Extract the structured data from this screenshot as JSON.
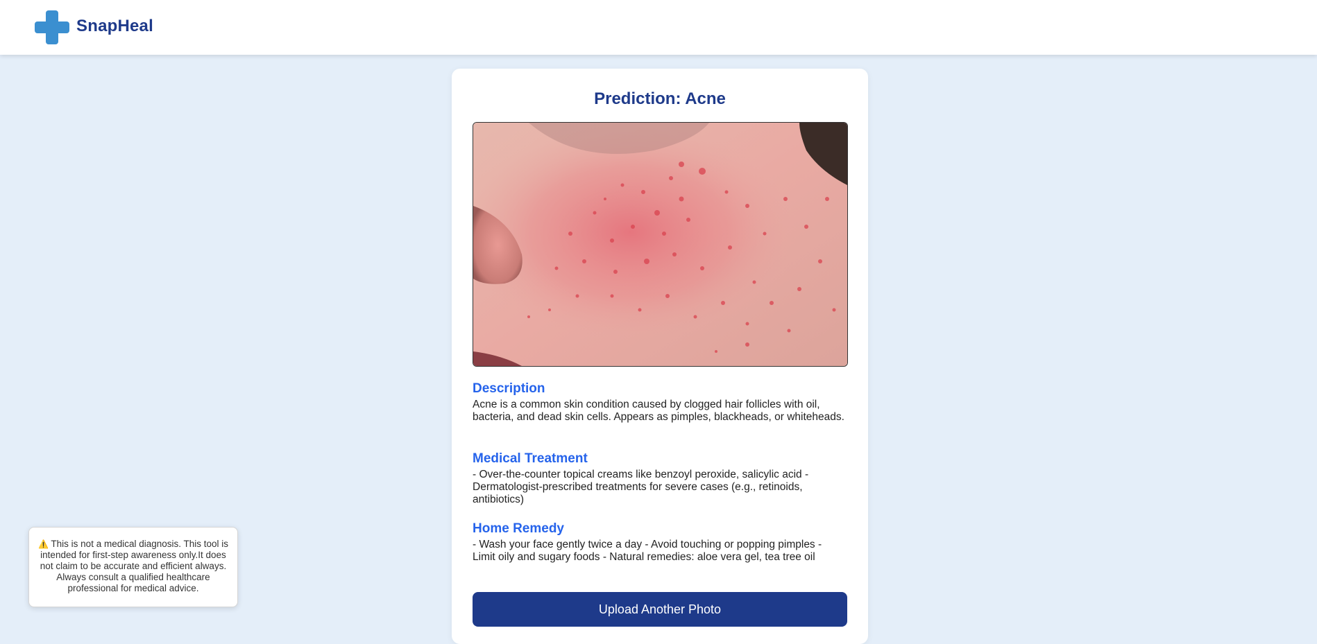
{
  "header": {
    "brand": "SnapHeal",
    "logo_icon": "medical-cross-icon",
    "accent_color": "#3b8fd0"
  },
  "result": {
    "prediction_label": "Prediction: Acne",
    "photo_alt": "Uploaded skin photo",
    "sections": [
      {
        "heading": "Description",
        "body": "Acne is a common skin condition caused by clogged hair follicles with oil, bacteria, and dead skin cells. Appears as pimples, blackheads, or whiteheads."
      },
      {
        "heading": "Medical Treatment",
        "body": "- Over-the-counter topical creams like benzoyl peroxide, salicylic acid - Dermatologist-prescribed treatments for severe cases (e.g., retinoids, antibiotics)"
      },
      {
        "heading": "Home Remedy",
        "body": "- Wash your face gently twice a day - Avoid touching or popping pimples - Limit oily and sugary foods - Natural remedies: aloe vera gel, tea tree oil"
      }
    ],
    "upload_button_label": "Upload Another Photo"
  },
  "disclaimer": {
    "icon": "warning-icon",
    "text": "This is not a medical diagnosis. This tool is intended for first-step awareness only.It does not claim to be accurate and efficient always. Always consult a qualified healthcare professional for medical advice."
  },
  "colors": {
    "background": "#e4eef9",
    "primary": "#1e3a8a",
    "section_heading": "#2563eb"
  }
}
